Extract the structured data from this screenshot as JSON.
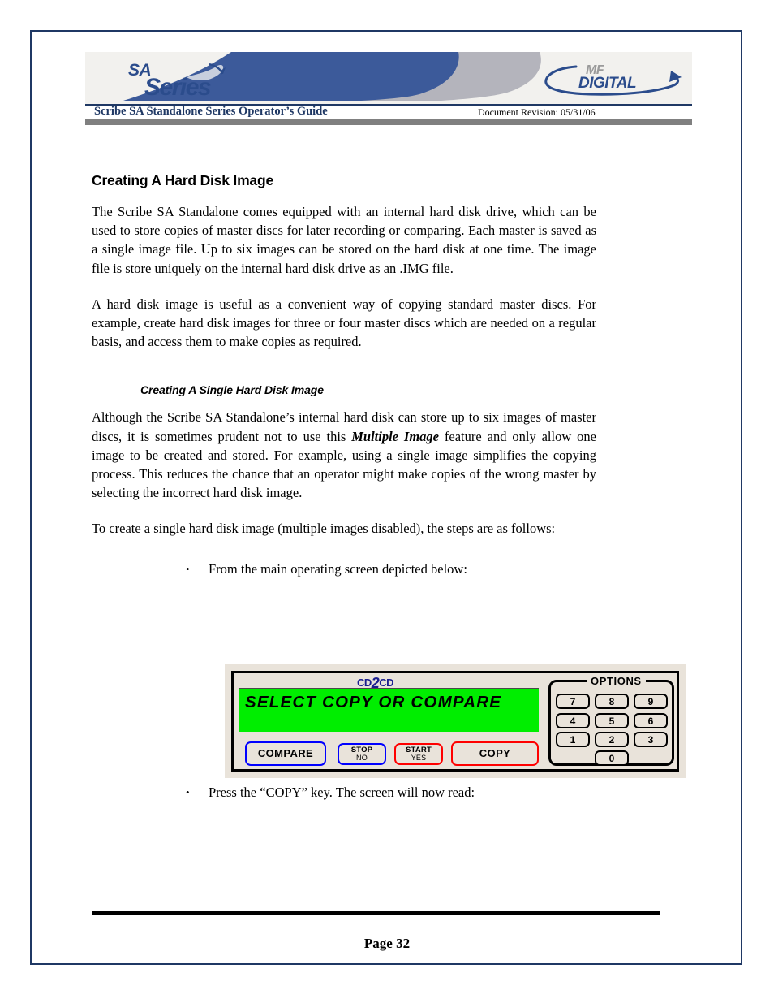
{
  "header": {
    "logo_sa": {
      "line1": "SA",
      "line2": "Series"
    },
    "logo_mf": {
      "line1": "MF",
      "line2": "DIGITAL"
    },
    "title": "Scribe SA Standalone Series Operator’s Guide",
    "revision": "Document Revision: 05/31/06",
    "colors": {
      "navy": "#1f3864",
      "banner_blue": "#3c5a9a",
      "banner_gray": "#b4b4bc",
      "gray_bar": "#808080"
    }
  },
  "content": {
    "section_title": "Creating A Hard Disk Image",
    "para1": "The Scribe SA Standalone comes equipped with an internal hard disk drive, which can be used to store copies of master discs for later recording or comparing. Each master is saved as a single image file. Up to six images can be stored on the hard disk at one time.  The image file is store uniquely on the internal hard disk drive as an .IMG file.",
    "para2": "A hard disk image is useful as a convenient way of copying standard master discs. For example, create hard disk images for three or four master discs which are needed on a regular basis, and access them to make copies as required.",
    "sub_title": "Creating A Single Hard Disk Image",
    "para3_part1": "Although the Scribe SA Standalone’s internal hard disk can store up to six images of master discs, it is sometimes prudent not to use this ",
    "para3_emphasis": "Multiple Image",
    "para3_part2": " feature and only allow one image to be created and stored. For example, using a single image simplifies the copying process. This reduces the chance that an operator might make copies of the wrong master by selecting the incorrect hard disk image.",
    "para4": "To create a single hard disk image (multiple images disabled), the steps are as follows:",
    "bullet1": "From the main operating screen depicted below:",
    "bullet2": "Press the “COPY” key. The screen will now read:",
    "bullet_glyph": "•"
  },
  "panel": {
    "brand": {
      "prefix": "CD",
      "two": "2",
      "suffix": "CD"
    },
    "lcd_text": "SELECT COPY OR COMPARE",
    "lcd_color": "#00ee00",
    "buttons": [
      {
        "id": "compare",
        "line1": "COMPARE",
        "line2": "",
        "border": "#0000ff",
        "single": true
      },
      {
        "id": "stop",
        "line1": "STOP",
        "line2": "NO",
        "border": "#0000ff",
        "single": false
      },
      {
        "id": "start",
        "line1": "START",
        "line2": "YES",
        "border": "#ff0000",
        "single": false
      },
      {
        "id": "copy",
        "line1": "COPY",
        "line2": "",
        "border": "#ff0000",
        "single": true
      }
    ],
    "options_label": "OPTIONS",
    "keys": [
      "7",
      "8",
      "9",
      "4",
      "5",
      "6",
      "1",
      "2",
      "3",
      "0"
    ],
    "face_color": "#e9e3da"
  },
  "footer": {
    "page": "Page 32"
  }
}
